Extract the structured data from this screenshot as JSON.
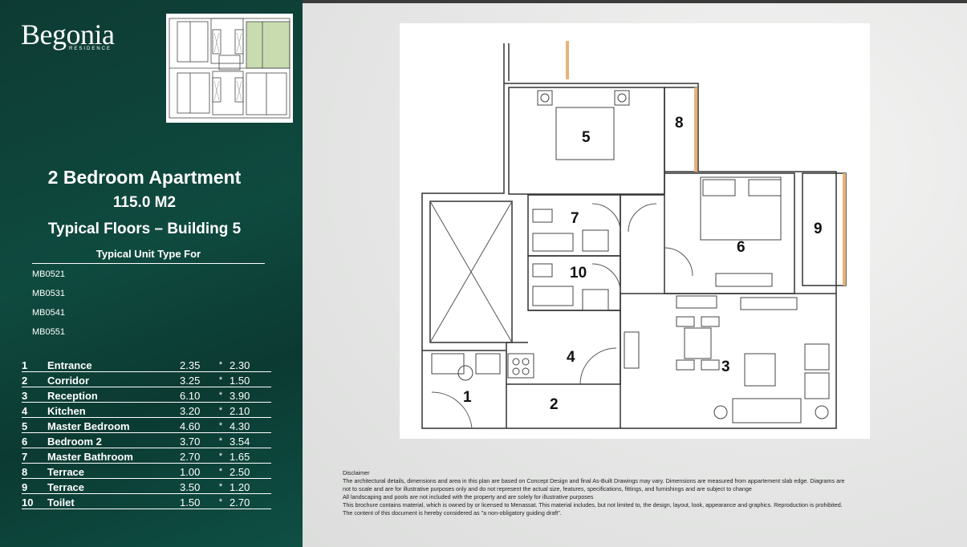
{
  "brand": {
    "name": "Begonia",
    "sub": "RESIDENCE"
  },
  "heading": {
    "title": "2 Bedroom Apartment",
    "area": "115.0 M2",
    "floors": "Typical Floors – Building 5",
    "unit_type_label": "Typical Unit Type For"
  },
  "units": [
    "MB0521",
    "MB0531",
    "MB0541",
    "MB0551"
  ],
  "rooms": [
    {
      "no": "1",
      "name": "Entrance",
      "w": "2.35",
      "x": "*",
      "h": "2.30"
    },
    {
      "no": "2",
      "name": "Corridor",
      "w": "3.25",
      "x": "*",
      "h": "1.50"
    },
    {
      "no": "3",
      "name": "Reception",
      "w": "6.10",
      "x": "*",
      "h": "3.90"
    },
    {
      "no": "4",
      "name": "Kitchen",
      "w": "3.20",
      "x": "*",
      "h": "2.10"
    },
    {
      "no": "5",
      "name": "Master Bedroom",
      "w": "4.60",
      "x": "*",
      "h": "4.30"
    },
    {
      "no": "6",
      "name": "Bedroom 2",
      "w": "3.70",
      "x": "*",
      "h": "3.54"
    },
    {
      "no": "7",
      "name": "Master Bathroom",
      "w": "2.70",
      "x": "*",
      "h": "1.65"
    },
    {
      "no": "8",
      "name": "Terrace",
      "w": "1.00",
      "x": "*",
      "h": "2.50"
    },
    {
      "no": "9",
      "name": "Terrace",
      "w": "3.50",
      "x": "*",
      "h": "1.20"
    },
    {
      "no": "10",
      "name": "Toilet",
      "w": "1.50",
      "x": "*",
      "h": "2.70"
    }
  ],
  "plan_labels": {
    "r1": "1",
    "r2": "2",
    "r3": "3",
    "r4": "4",
    "r5": "5",
    "r6": "6",
    "r7": "7",
    "r8": "8",
    "r9": "9",
    "r10": "10"
  },
  "disclaimer": {
    "title": "Disclaimer",
    "lines": [
      "The architectural details, dimensions and area in this plan are based on Concept Design and final As-Built Drawings may vary. Dimensions are measured from appartement slab edge.  Diagrams are",
      "not to scale and are for illustrative purposes only and do not represent the actual size, features, specifications, fittings, and furnishings and are subject to change",
      "All landscaping and pools are not included with the property and are solely for illustrative purposes",
      "This brochure contains material, which is owned by or licensed to Menassat. This material includes, but not limited to, the design, layout, look, appearance and graphics. Reproduction is prohibited.",
      "The content of this document is hereby considered as \"a non-obligatory guiding draft\"."
    ]
  },
  "colors": {
    "panel": "#0f4a3f",
    "highlight": "#c8dcb0",
    "terrace": "#e8b27a"
  }
}
